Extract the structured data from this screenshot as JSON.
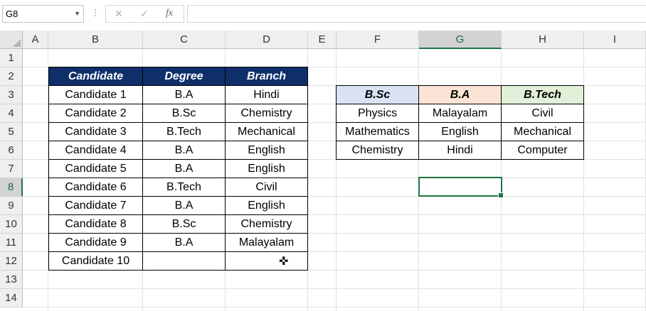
{
  "formula_bar": {
    "name_box": "G8",
    "cancel_icon": "✕",
    "enter_icon": "✓",
    "fx_label": "fx",
    "formula": ""
  },
  "columns": [
    "A",
    "B",
    "C",
    "D",
    "E",
    "F",
    "G",
    "H",
    "I"
  ],
  "rows": [
    "1",
    "2",
    "3",
    "4",
    "5",
    "6",
    "7",
    "8",
    "9",
    "10",
    "11",
    "12",
    "13",
    "14"
  ],
  "selected": {
    "column": "G",
    "row": "8"
  },
  "table1": {
    "headers": [
      "Candidate",
      "Degree",
      "Branch"
    ],
    "rows": [
      [
        "Candidate 1",
        "B.A",
        "Hindi"
      ],
      [
        "Candidate 2",
        "B.Sc",
        "Chemistry"
      ],
      [
        "Candidate 3",
        "B.Tech",
        "Mechanical"
      ],
      [
        "Candidate 4",
        "B.A",
        "English"
      ],
      [
        "Candidate 5",
        "B.A",
        "English"
      ],
      [
        "Candidate 6",
        "B.Tech",
        "Civil"
      ],
      [
        "Candidate 7",
        "B.A",
        "English"
      ],
      [
        "Candidate 8",
        "B.Sc",
        "Chemistry"
      ],
      [
        "Candidate 9",
        "B.A",
        "Malayalam"
      ],
      [
        "Candidate 10",
        "",
        ""
      ]
    ]
  },
  "table2": {
    "headers": [
      "B.Sc",
      "B.A",
      "B.Tech"
    ],
    "rows": [
      [
        "Physics",
        "Malayalam",
        "Civil"
      ],
      [
        "Mathematics",
        "English",
        "Mechanical"
      ],
      [
        "Chemistry",
        "Hindi",
        "Computer"
      ]
    ]
  },
  "colors": {
    "header_dark": "#0f2f6b",
    "bsc": "#dae3f3",
    "ba": "#fbe4d5",
    "btech": "#e2efd9",
    "selection": "#217346"
  }
}
